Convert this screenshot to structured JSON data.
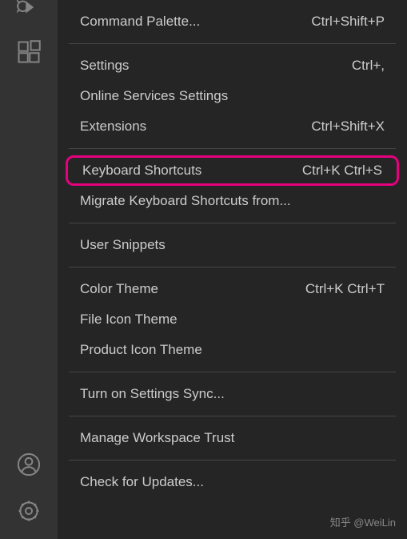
{
  "activity_bar": {
    "icons": {
      "debug": "debug-icon",
      "extensions": "extensions-icon",
      "account": "account-icon",
      "settings": "gear-icon"
    }
  },
  "menu": {
    "groups": [
      {
        "items": [
          {
            "label": "Command Palette...",
            "shortcut": "Ctrl+Shift+P",
            "highlighted": false
          }
        ]
      },
      {
        "items": [
          {
            "label": "Settings",
            "shortcut": "Ctrl+,",
            "highlighted": false
          },
          {
            "label": "Online Services Settings",
            "shortcut": "",
            "highlighted": false
          },
          {
            "label": "Extensions",
            "shortcut": "Ctrl+Shift+X",
            "highlighted": false
          }
        ]
      },
      {
        "items": [
          {
            "label": "Keyboard Shortcuts",
            "shortcut": "Ctrl+K Ctrl+S",
            "highlighted": true
          },
          {
            "label": "Migrate Keyboard Shortcuts from...",
            "shortcut": "",
            "highlighted": false
          }
        ]
      },
      {
        "items": [
          {
            "label": "User Snippets",
            "shortcut": "",
            "highlighted": false
          }
        ]
      },
      {
        "items": [
          {
            "label": "Color Theme",
            "shortcut": "Ctrl+K Ctrl+T",
            "highlighted": false
          },
          {
            "label": "File Icon Theme",
            "shortcut": "",
            "highlighted": false
          },
          {
            "label": "Product Icon Theme",
            "shortcut": "",
            "highlighted": false
          }
        ]
      },
      {
        "items": [
          {
            "label": "Turn on Settings Sync...",
            "shortcut": "",
            "highlighted": false
          }
        ]
      },
      {
        "items": [
          {
            "label": "Manage Workspace Trust",
            "shortcut": "",
            "highlighted": false
          }
        ]
      },
      {
        "items": [
          {
            "label": "Check for Updates...",
            "shortcut": "",
            "highlighted": false
          }
        ]
      }
    ]
  },
  "watermark": {
    "label": "知乎 @WeiLin"
  },
  "colors": {
    "highlight_border": "#e6007e",
    "menu_bg": "#252526",
    "activity_bg": "#333333",
    "text": "#cccccc"
  }
}
